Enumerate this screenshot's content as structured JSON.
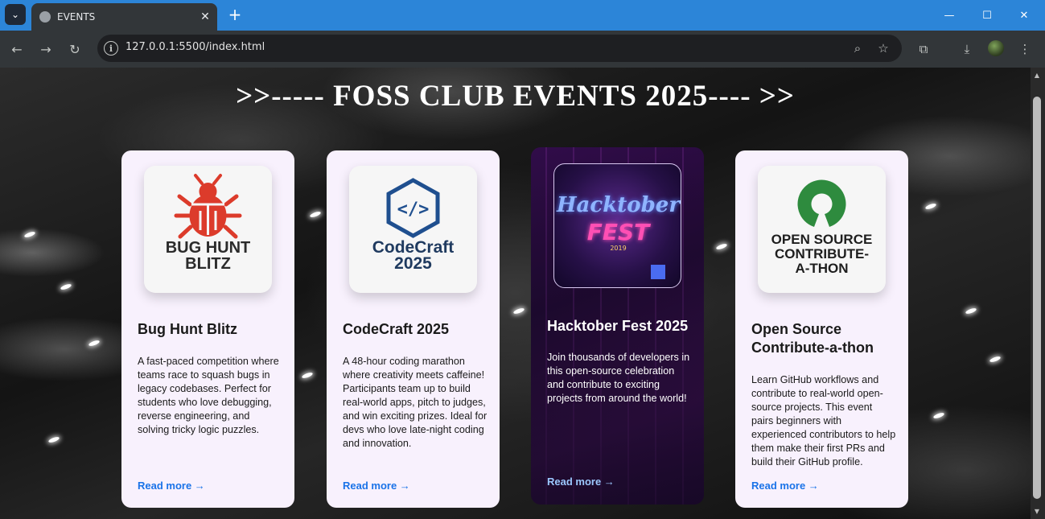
{
  "browser": {
    "tab_title": "EVENTS",
    "url": "127.0.0.1:5500/index.html",
    "new_tab_glyph": "+",
    "close_glyph": "✕"
  },
  "page": {
    "title": ">>----- FOSS CLUB EVENTS 2025---- >>"
  },
  "cards": [
    {
      "logo_text": [
        "BUG HUNT",
        "BLITZ"
      ],
      "title": "Bug Hunt Blitz",
      "description": "A fast-paced competition where teams race to squash bugs in legacy codebases. Perfect for students who love debugging, reverse engineering, and solving tricky logic puzzles.",
      "link": "Read more →",
      "logo_color": "#dc3b2b"
    },
    {
      "logo_text": [
        "CodeCraft",
        "2025"
      ],
      "logo_glyph": "</>",
      "title": "CodeCraft 2025",
      "description": "A 48-hour coding marathon where creativity meets caffeine! Participants team up to build real-world apps, pitch to judges, and win exciting prizes. Ideal for devs who love late-night coding and innovation.",
      "link": "Read more →",
      "logo_color": "#1f4f8f"
    },
    {
      "logo_text": [
        "Hacktober",
        "FEST",
        "2019"
      ],
      "title": "Hacktober Fest 2025",
      "description": "Join thousands of developers in this open-source celebration and contribute to exciting projects from around the world!",
      "link": "Read more →",
      "logo_color": "#7fa8ff"
    },
    {
      "logo_text": [
        "OPEN SOURCE",
        "CONTRIBUTE-",
        "A-THON"
      ],
      "title": "Open Source Contribute-a-thon",
      "description": "Learn GitHub workflows and contribute to real-world open-source projects. This event pairs beginners with experienced contributors to help them make their first PRs and build their GitHub profile.",
      "link": "Read more →",
      "logo_color": "#2e8b3e"
    }
  ]
}
